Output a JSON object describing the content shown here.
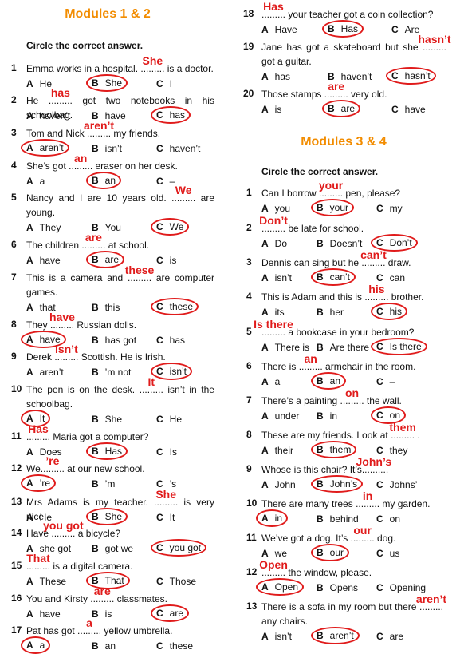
{
  "left": {
    "title": "Modules 1 & 2",
    "instruction": "Circle the correct answer.",
    "questions": [
      {
        "num": "1",
        "before": "Emma works in a hospital. ",
        "after": " is a doctor.",
        "answer": "She",
        "options": [
          "He",
          "She",
          "I"
        ],
        "correct": 1
      },
      {
        "num": "2",
        "before": "He ",
        "after": " got two notebooks in his schoolbag.",
        "answer": "has",
        "options": [
          "haven’t",
          "have",
          "has"
        ],
        "correct": 2
      },
      {
        "num": "3",
        "before": "Tom and Nick ",
        "after": " my friends.",
        "answer": "aren’t",
        "options": [
          "aren’t",
          "isn’t",
          "haven’t"
        ],
        "correct": 0
      },
      {
        "num": "4",
        "before": "She’s got ",
        "after": " eraser on her desk.",
        "answer": "an",
        "options": [
          "a",
          "an",
          "–"
        ],
        "correct": 1
      },
      {
        "num": "5",
        "before": "Nancy and I are 10 years old. ",
        "after": " are young.",
        "answer": "We",
        "options": [
          "They",
          "You",
          "We"
        ],
        "correct": 2
      },
      {
        "num": "6",
        "before": "The children ",
        "after": " at school.",
        "answer": "are",
        "options": [
          "have",
          "are",
          "is"
        ],
        "correct": 1
      },
      {
        "num": "7",
        "before": "This is a camera and ",
        "after": " are computer games.",
        "answer": "these",
        "options": [
          "that",
          "this",
          "these"
        ],
        "correct": 2
      },
      {
        "num": "8",
        "before": "They ",
        "after": " Russian dolls.",
        "answer": "have",
        "options": [
          "have",
          "has got",
          "has"
        ],
        "correct": 0
      },
      {
        "num": "9",
        "before": "Derek ",
        "after": " Scottish. He is Irish.",
        "answer": "isn’t",
        "options": [
          "aren’t",
          "’m not",
          "isn’t"
        ],
        "correct": 2
      },
      {
        "num": "10",
        "before": "The pen is on the desk. ",
        "after": " isn’t in the schoolbag.",
        "answer": "It",
        "options": [
          "It",
          "She",
          "He"
        ],
        "correct": 0
      },
      {
        "num": "11",
        "before": "",
        "after": " Maria got a computer?",
        "answer": "Has",
        "options": [
          "Does",
          "Has",
          "Is"
        ],
        "correct": 1
      },
      {
        "num": "12",
        "before": "We",
        "after": " at our new school.",
        "answer": "’re",
        "options": [
          "’re",
          "’m",
          "’s"
        ],
        "correct": 0
      },
      {
        "num": "13",
        "before": "Mrs Adams is my teacher. ",
        "after": " is very nice.",
        "answer": "She",
        "options": [
          "He",
          "She",
          "It"
        ],
        "correct": 1
      },
      {
        "num": "14",
        "before": "Have ",
        "after": " a bicycle?",
        "answer": "you  got",
        "options": [
          "she got",
          "got we",
          "you got"
        ],
        "correct": 2
      },
      {
        "num": "15",
        "before": "",
        "after": " is a digital camera.",
        "answer": "That",
        "options": [
          "These",
          "That",
          "Those"
        ],
        "correct": 1
      },
      {
        "num": "16",
        "before": "You and Kirsty ",
        "after": " classmates.",
        "answer": "are",
        "options": [
          "have",
          "is",
          "are"
        ],
        "correct": 2
      },
      {
        "num": "17",
        "before": "Pat has got ",
        "after": " yellow umbrella.",
        "answer": "a",
        "options": [
          "a",
          "an",
          "these"
        ],
        "correct": 0
      }
    ]
  },
  "right_top": {
    "questions": [
      {
        "num": "18",
        "before": "",
        "after": " your teacher got a coin collection?",
        "answer": "Has",
        "options": [
          "Have",
          "Has",
          "Are"
        ],
        "correct": 1
      },
      {
        "num": "19",
        "before": "Jane has got a skateboard but she ",
        "after": " got a guitar.",
        "answer": "hasn’t",
        "options": [
          "has",
          "haven’t",
          "hasn’t"
        ],
        "correct": 2
      },
      {
        "num": "20",
        "before": "Those stamps ",
        "after": " very old.",
        "answer": "are",
        "options": [
          "is",
          "are",
          "have"
        ],
        "correct": 1
      }
    ]
  },
  "right": {
    "title": "Modules 3 & 4",
    "instruction": "Circle the correct answer.",
    "questions": [
      {
        "num": "1",
        "before": "Can I borrow ",
        "after": " pen, please?",
        "answer": "your",
        "options": [
          "you",
          "your",
          "my"
        ],
        "correct": 1
      },
      {
        "num": "2",
        "before": "",
        "after": " be late for school.",
        "answer": "Don’t",
        "options": [
          "Do",
          "Doesn’t",
          "Don’t"
        ],
        "correct": 2
      },
      {
        "num": "3",
        "before": "Dennis can sing but he ",
        "after": " draw.",
        "answer": "can’t",
        "options": [
          "isn’t",
          "can’t",
          "can"
        ],
        "correct": 1
      },
      {
        "num": "4",
        "before": "This is Adam and this is ",
        "after": " brother.",
        "answer": "his",
        "options": [
          "its",
          "her",
          "his"
        ],
        "correct": 2
      },
      {
        "num": "5",
        "before": "",
        "after": " a bookcase in your bedroom?",
        "answer": "Is  there",
        "options": [
          "There is",
          "Are there",
          "Is there"
        ],
        "correct": 2
      },
      {
        "num": "6",
        "before": "There is ",
        "after": " armchair in the room.",
        "answer": "an",
        "options": [
          "a",
          "an",
          "–"
        ],
        "correct": 1
      },
      {
        "num": "7",
        "before": "There’s a painting ",
        "after": " the wall.",
        "answer": "on",
        "options": [
          "under",
          "in",
          "on"
        ],
        "correct": 2
      },
      {
        "num": "8",
        "before": "These are my friends. Look at ",
        "after": " .",
        "answer": "them",
        "options": [
          "their",
          "them",
          "they"
        ],
        "correct": 1
      },
      {
        "num": "9",
        "before": "Whose is this chair? It’s",
        "after": ".",
        "answer": "John’s",
        "options": [
          "John",
          "John’s",
          "Johns’"
        ],
        "correct": 1
      },
      {
        "num": "10",
        "before": "There are many trees ",
        "after": " my garden.",
        "answer": "in",
        "options": [
          "in",
          "behind",
          "on"
        ],
        "correct": 0
      },
      {
        "num": "11",
        "before": "We’ve got a dog. It’s ",
        "after": " dog.",
        "answer": "our",
        "options": [
          "we",
          "our",
          "us"
        ],
        "correct": 1
      },
      {
        "num": "12",
        "before": "",
        "after": " the window, please.",
        "answer": "Open",
        "options": [
          "Open",
          "Opens",
          "Opening"
        ],
        "correct": 0
      },
      {
        "num": "13",
        "before": "There is a sofa in my room but there ",
        "after": " any chairs.",
        "answer": "aren’t",
        "options": [
          "isn’t",
          "aren’t",
          "are"
        ],
        "correct": 1
      }
    ]
  },
  "option_letters": [
    "A",
    "B",
    "C"
  ],
  "blank": ".........",
  "colors": {
    "title": "#f28c00",
    "answer": "#e01b1b",
    "circle": "#e01b1b"
  }
}
